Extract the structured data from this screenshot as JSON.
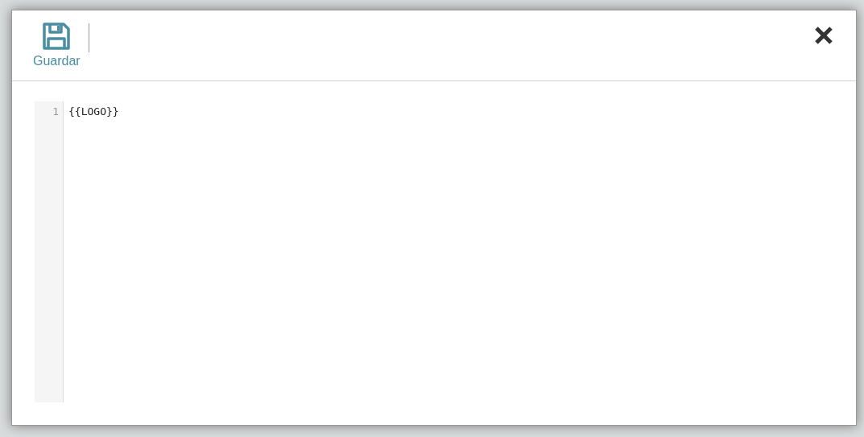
{
  "toolbar": {
    "buttons": [
      {
        "label": "Guardar"
      }
    ]
  },
  "editor": {
    "lines": [
      {
        "number": "1",
        "text": "{{LOGO}}"
      }
    ]
  }
}
